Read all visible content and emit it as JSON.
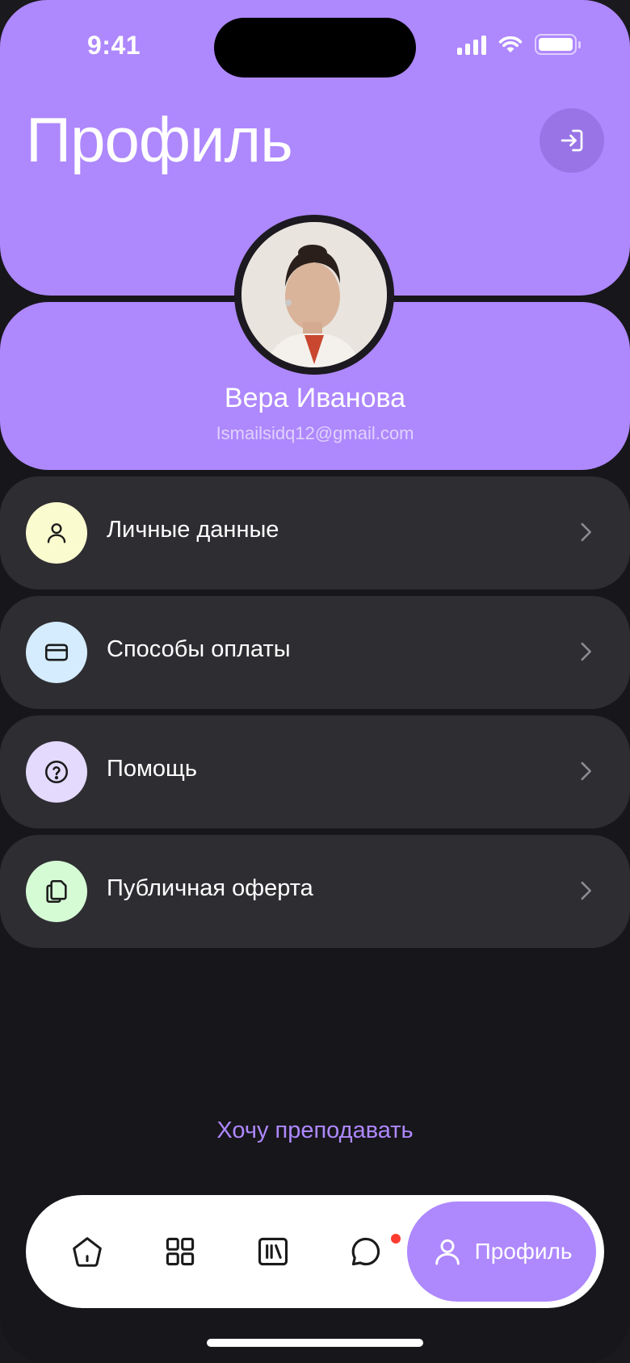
{
  "status_bar": {
    "time": "9:41"
  },
  "header": {
    "title": "Профиль"
  },
  "profile": {
    "name": "Вера Иванова",
    "email": "Ismailsidq12@gmail.com"
  },
  "menu": [
    {
      "label": "Личные данные",
      "icon": "user-icon",
      "icon_bg": "#fbfbd0"
    },
    {
      "label": "Способы оплаты",
      "icon": "card-icon",
      "icon_bg": "#d4ecfd"
    },
    {
      "label": "Помощь",
      "icon": "help-icon",
      "icon_bg": "#e3dafd"
    },
    {
      "label": "Публичная оферта",
      "icon": "documents-icon",
      "icon_bg": "#d5fbd5"
    }
  ],
  "teach_link": "Хочу преподавать",
  "tabbar": {
    "tabs": [
      "home-icon",
      "catalog-grid-icon",
      "library-icon",
      "chat-icon",
      "profile-icon"
    ],
    "active_label": "Профиль"
  },
  "colors": {
    "accent": "#ae88fd",
    "background": "#17161b",
    "card": "#2e2d32"
  }
}
